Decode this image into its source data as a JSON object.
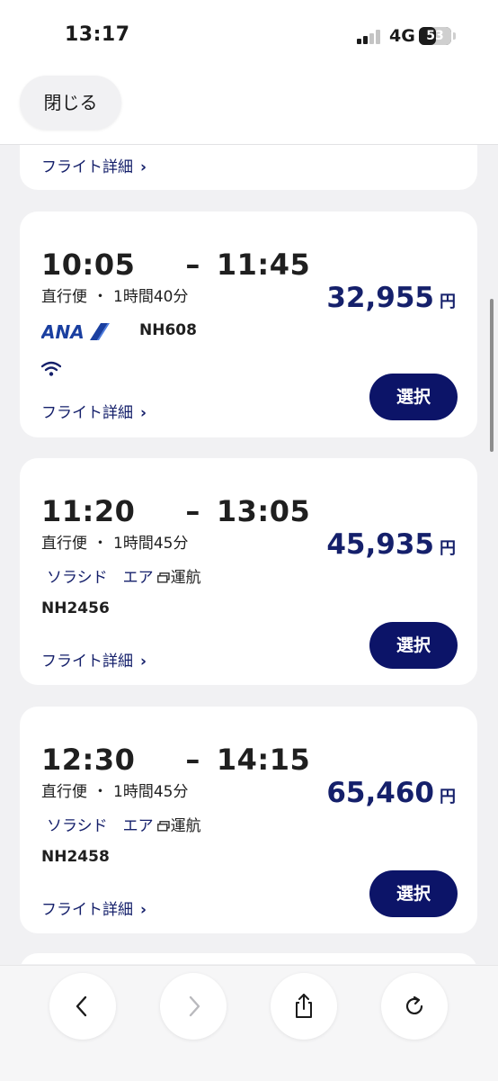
{
  "status_bar": {
    "time": "13:17",
    "network": "4G",
    "battery": "53"
  },
  "header": {
    "close_label": "閉じる"
  },
  "common": {
    "detail_label": "フライト詳細",
    "select_label": "選択",
    "yen": "円"
  },
  "cards": [
    {
      "depart": "10:05",
      "arrive": "11:45",
      "type": "直行便",
      "duration": "1時間40分",
      "price": "32,955",
      "airline_logo_text": "ANA",
      "flight_no": "NH608",
      "wifi": true
    },
    {
      "depart": "11:20",
      "arrive": "13:05",
      "type": "直行便",
      "duration": "1時間45分",
      "price": "45,935",
      "operated_by": "ソラシド　エア",
      "operated_suffix": "運航",
      "flight_no": "NH2456"
    },
    {
      "depart": "12:30",
      "arrive": "14:15",
      "type": "直行便",
      "duration": "1時間45分",
      "price": "65,460",
      "operated_by": "ソラシド　エア",
      "operated_suffix": "運航",
      "flight_no": "NH2458"
    }
  ],
  "separators": {
    "dash": "–",
    "dot": "・",
    "chevron": "›"
  },
  "colors": {
    "brand_navy": "#0c1468",
    "price_navy": "#15206b",
    "background": "#f1f1f3"
  },
  "browser_nav": {
    "back_icon": "chevron-left-icon",
    "forward_icon": "chevron-right-icon",
    "share_icon": "share-icon",
    "reload_icon": "reload-icon"
  }
}
